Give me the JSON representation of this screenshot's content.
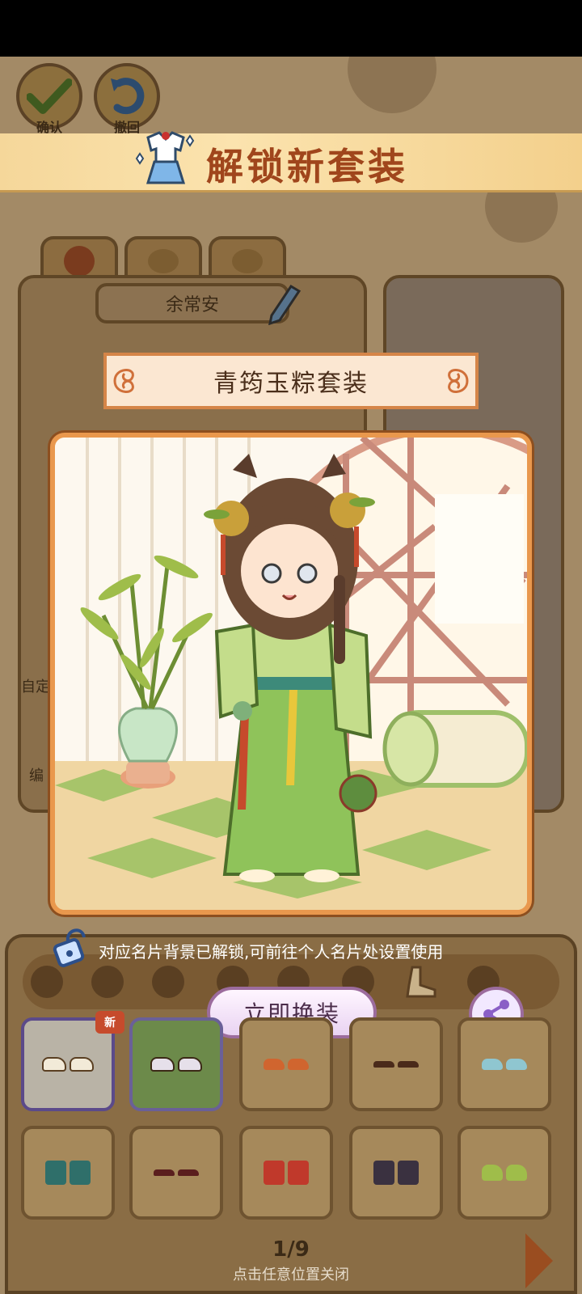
{
  "toolbar": {
    "confirm_label": "确认",
    "undo_label": "撤回"
  },
  "banner": {
    "title": "解锁新套装"
  },
  "profile": {
    "name": "余常安",
    "tabs": [
      "face-tab",
      "cat-tab",
      "dog-tab"
    ],
    "side_labels": [
      "自定",
      "编"
    ]
  },
  "outfit": {
    "name": "青筠玉粽套装"
  },
  "unlock_note": {
    "text": "对应名片背景已解锁,可前往个人名片处设置使用"
  },
  "actions": {
    "change_label": "立即换装"
  },
  "items": {
    "new_badge": "新"
  },
  "pagination": {
    "current": "1/9",
    "close_hint": "点击任意位置关闭"
  },
  "colors": {
    "accent_orange": "#e9984d",
    "banner_text": "#a0461c",
    "button_border": "#9c6c9d"
  }
}
